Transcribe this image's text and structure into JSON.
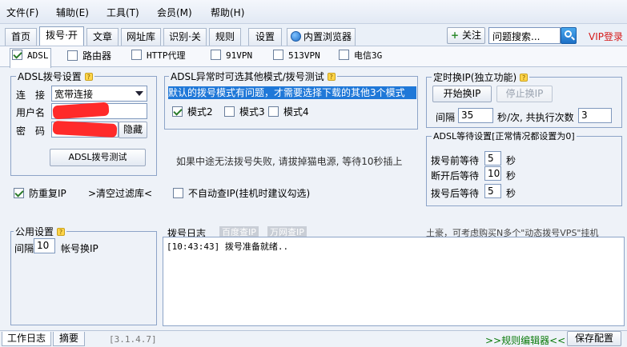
{
  "menubar": {
    "items": [
      "文件(F)",
      "辅助(E)",
      "工具(T)",
      "会员(M)",
      "帮助(H)"
    ]
  },
  "main_tabs": {
    "items": [
      "首页",
      "拨号·开",
      "文章",
      "网址库",
      "识别·关",
      "规则",
      "设置",
      "内置浏览器"
    ],
    "active": "拨号·开"
  },
  "toolbar": {
    "follow_label": "关注",
    "search_placeholder": "问题搜索...",
    "vip_login": "VIP登录"
  },
  "sub_tabs": {
    "items": [
      "ADSL",
      "路由器",
      "HTTP代理",
      "91VPN",
      "513VPN",
      "电信3G"
    ],
    "active": "ADSL"
  },
  "adsl_dial": {
    "title": "ADSL拨号设置",
    "connect_label": "连　接",
    "connect_value": "宽带连接",
    "username_label": "用户名",
    "password_label": "密　码",
    "hide_button": "隐藏",
    "test_button": "ADSL拨号测试"
  },
  "adsl_alt": {
    "title": "ADSL异常时可选其他模式/拨号测试",
    "notice": "默认的拨号模式有问题，才需要选择下载的其他3个模式",
    "modes": [
      {
        "label": "模式2",
        "checked": true
      },
      {
        "label": "模式3",
        "checked": false
      },
      {
        "label": "模式4",
        "checked": false
      }
    ]
  },
  "timer_change": {
    "title": "定时换IP(独立功能)",
    "start_button": "开始换IP",
    "stop_button": "停止换IP",
    "interval_label": "间隔",
    "interval_value": "35",
    "per_label": "秒/次, 共执行次数",
    "count_value": "3"
  },
  "adsl_wait": {
    "title": "ADSL等待设置[正常情况都设置为0]",
    "rows": [
      {
        "label": "拨号前等待",
        "value": "5",
        "unit": "秒"
      },
      {
        "label": "断开后等待",
        "value": "10",
        "unit": "秒"
      },
      {
        "label": "拨号后等待",
        "value": "5",
        "unit": "秒"
      }
    ]
  },
  "hint_text": "如果中途无法拨号失败, 请拔掉猫电源, 等待10秒插上",
  "options": {
    "prevent_repeat_ip": "防重复IP",
    "clear_filter": ">清空过滤库<",
    "no_auto_check": "不自动查IP(挂机时建议勾选)"
  },
  "public_settings": {
    "title": "公用设置",
    "interval_label": "间隔",
    "interval_value": "10",
    "suffix": "帐号换IP"
  },
  "dial_log": {
    "title": "拨号日志",
    "link_baidu": "百度查IP",
    "link_wanwang": "万网查IP",
    "promo": "土豪，可考虑购买N多个\"动态拨号VPS\"挂机",
    "entries": [
      "[10:43:43] 拨号准备就绪.."
    ]
  },
  "bottom": {
    "tabs": [
      "工作日志",
      "摘要"
    ],
    "version": "[3.1.4.7]",
    "rule_editor": ">>规则编辑器<<",
    "save_button": "保存配置"
  },
  "colors": {
    "accent": "#1d6fc6",
    "vip": "#d61a1a",
    "notice_bg": "#1f78d8",
    "promo_green": "#0a7a0a"
  }
}
